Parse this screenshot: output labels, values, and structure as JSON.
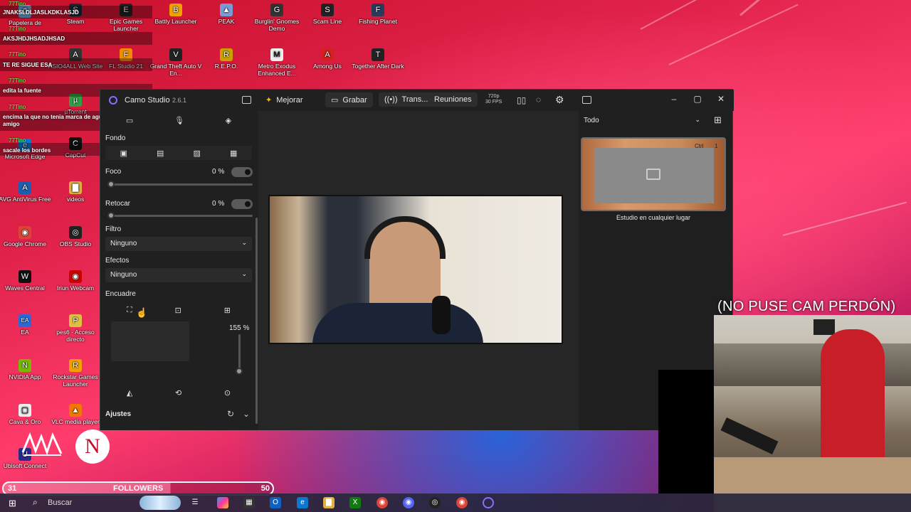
{
  "chat": [
    {
      "name": "77Tino",
      "message": "JNAKSLDLJASLKDKLASJD"
    },
    {
      "name": "77Tino",
      "message": "AKSJHDJHSADJHSAD"
    },
    {
      "name": "77Tino",
      "message": "TE RE SIGUE ESA"
    },
    {
      "name": "77Tino",
      "message": "edita la fuente"
    },
    {
      "name": "77Tino",
      "message": "encima la que no tenia marca de agua la borraste amigo"
    },
    {
      "name": "77Tino",
      "message": "sacale los bordes"
    }
  ],
  "desktop_icons": [
    {
      "label": "Papelera de",
      "glyph": "♻",
      "color": "#6fa8dc"
    },
    {
      "label": "Steam",
      "glyph": "S",
      "color": "#1b2838"
    },
    {
      "label": "Epic Games Launcher",
      "glyph": "E",
      "color": "#222"
    },
    {
      "label": "Battly Launcher",
      "glyph": "B",
      "color": "#f2a100"
    },
    {
      "label": "PEAK",
      "glyph": "▲",
      "color": "#7a9ad6"
    },
    {
      "label": "Burglin' Gnomes Demo",
      "glyph": "G",
      "color": "#333"
    },
    {
      "label": "Scam Line",
      "glyph": "S",
      "color": "#222"
    },
    {
      "label": "Fishing Planet",
      "glyph": "F",
      "color": "#2a3a5a"
    },
    {
      "label": "ASIO4ALL Web Site",
      "glyph": "A",
      "color": "#333"
    },
    {
      "label": "FL Studio 21",
      "glyph": "F",
      "color": "#f28c00"
    },
    {
      "label": "Grand Theft Auto V En...",
      "glyph": "V",
      "color": "#222"
    },
    {
      "label": "R.E.P.O.",
      "glyph": "R",
      "color": "#caa000"
    },
    {
      "label": "Metro Exodus Enhanced E...",
      "glyph": "M",
      "color": "#eee"
    },
    {
      "label": "Among Us",
      "glyph": "A",
      "color": "#d42020"
    },
    {
      "label": "Together After Dark",
      "glyph": "T",
      "color": "#222"
    },
    {
      "label": "µTorrent",
      "glyph": "µ",
      "color": "#2ea043"
    },
    {
      "label": "Microsoft Edge",
      "glyph": "e",
      "color": "#0b78d0"
    },
    {
      "label": "CapCut",
      "glyph": "C",
      "color": "#111"
    },
    {
      "label": "AVG AntiVirus Free",
      "glyph": "A",
      "color": "#1b5fb3"
    },
    {
      "label": "videos",
      "glyph": "▇",
      "color": "#e0b040"
    },
    {
      "label": "Google Chrome",
      "glyph": "◉",
      "color": "#db4437"
    },
    {
      "label": "OBS Studio",
      "glyph": "◎",
      "color": "#222"
    },
    {
      "label": "Waves Central",
      "glyph": "W",
      "color": "#111"
    },
    {
      "label": "Iriun Webcam",
      "glyph": "◉",
      "color": "#c00"
    },
    {
      "label": "EA",
      "glyph": "EA",
      "color": "#2a6ad8"
    },
    {
      "label": "pes6 - Acceso directo",
      "glyph": "P",
      "color": "#e0c040"
    },
    {
      "label": "NVIDIA App",
      "glyph": "N",
      "color": "#76b900"
    },
    {
      "label": "Rockstar Games Launcher",
      "glyph": "R",
      "color": "#f2a100"
    },
    {
      "label": "Cava & Oro",
      "glyph": "▢",
      "color": "#eee"
    },
    {
      "label": "VLC media player",
      "glyph": "▲",
      "color": "#f07800"
    },
    {
      "label": "Ubisoft Connect",
      "glyph": "U",
      "color": "#2a2a8a"
    }
  ],
  "camo": {
    "app_name": "Camo Studio",
    "version": "2.6.1",
    "toolbar": {
      "mejorar": "Mejorar",
      "grabar": "Grabar",
      "trans": "Trans...",
      "reuniones": "Reuniones",
      "res": "720p",
      "fps": "30 FPS"
    },
    "left": {
      "fondo": "Fondo",
      "foco": "Foco",
      "foco_value": "0 %",
      "retocar": "Retocar",
      "retocar_value": "0 %",
      "filtro": "Filtro",
      "filtro_value": "Ninguno",
      "efectos": "Efectos",
      "efectos_value": "Ninguno",
      "encuadre": "Encuadre",
      "zoom_value": "155 %",
      "ajustes": "Ajustes"
    },
    "right": {
      "filter_value": "Todo",
      "thumb_shortcut": "Ctrl",
      "thumb_number": "1",
      "thumb_label": "Estudio en cualquier lugar"
    }
  },
  "followers": {
    "current": "31",
    "label": "FOLLOWERS",
    "goal": "50",
    "progress": 0.62
  },
  "taskbar": {
    "search_label": "Buscar"
  },
  "cam_caption": "(NO PUSE CAM PERDÓN)"
}
